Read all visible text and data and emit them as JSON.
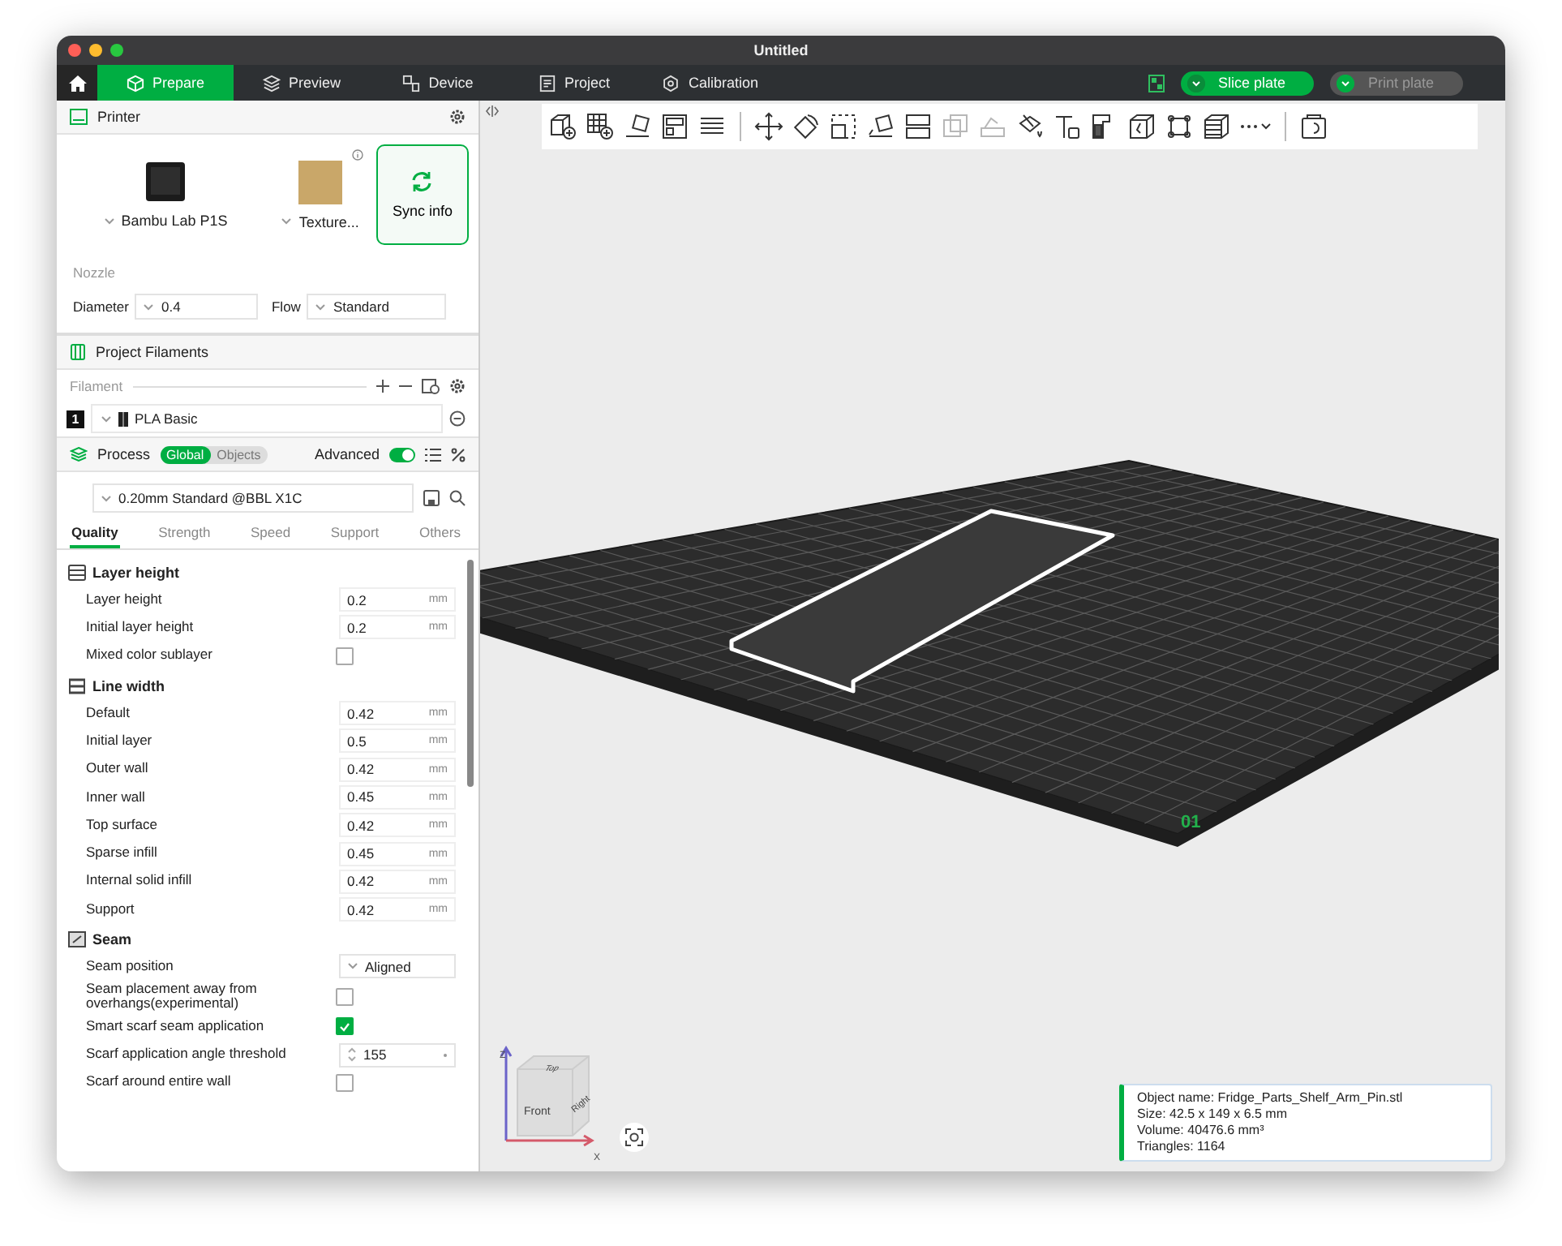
{
  "window": {
    "title": "Untitled"
  },
  "topbar": {
    "tabs": [
      {
        "label": "Prepare",
        "selected": true
      },
      {
        "label": "Preview",
        "selected": false
      },
      {
        "label": "Device",
        "selected": false
      },
      {
        "label": "Project",
        "selected": false
      },
      {
        "label": "Calibration",
        "selected": false
      }
    ],
    "slice_button": {
      "label": "Slice plate",
      "disabled": false
    },
    "print_button": {
      "label": "Print plate",
      "disabled": true
    }
  },
  "printer": {
    "title": "Printer",
    "printer_name": "Bambu Lab P1S",
    "plate_name": "Texture...",
    "sync_label": "Sync info",
    "nozzle_label": "Nozzle",
    "diameter_label": "Diameter",
    "diameter_value": "0.4",
    "flow_label": "Flow",
    "flow_value": "Standard"
  },
  "filaments": {
    "title": "Project Filaments",
    "filament_label": "Filament",
    "items": [
      {
        "index": "1",
        "name": "PLA Basic"
      }
    ]
  },
  "process": {
    "title": "Process",
    "scope_tabs": [
      {
        "label": "Global",
        "selected": true
      },
      {
        "label": "Objects",
        "selected": false
      }
    ],
    "advanced_label": "Advanced",
    "advanced_on": true,
    "preset": "0.20mm Standard @BBL X1C",
    "tabs": [
      {
        "label": "Quality",
        "selected": true
      },
      {
        "label": "Strength",
        "selected": false
      },
      {
        "label": "Speed",
        "selected": false
      },
      {
        "label": "Support",
        "selected": false
      },
      {
        "label": "Others",
        "selected": false
      }
    ],
    "sections": [
      {
        "title": "Layer height",
        "rows": [
          {
            "label": "Layer height",
            "kind": "number",
            "value": "0.2",
            "unit": "mm"
          },
          {
            "label": "Initial layer height",
            "kind": "number",
            "value": "0.2",
            "unit": "mm"
          },
          {
            "label": "Mixed color sublayer",
            "kind": "checkbox",
            "checked": false
          }
        ]
      },
      {
        "title": "Line width",
        "rows": [
          {
            "label": "Default",
            "kind": "number",
            "value": "0.42",
            "unit": "mm"
          },
          {
            "label": "Initial layer",
            "kind": "number",
            "value": "0.5",
            "unit": "mm"
          },
          {
            "label": "Outer wall",
            "kind": "number",
            "value": "0.42",
            "unit": "mm"
          },
          {
            "label": "Inner wall",
            "kind": "number",
            "value": "0.45",
            "unit": "mm"
          },
          {
            "label": "Top surface",
            "kind": "number",
            "value": "0.42",
            "unit": "mm"
          },
          {
            "label": "Sparse infill",
            "kind": "number",
            "value": "0.45",
            "unit": "mm"
          },
          {
            "label": "Internal solid infill",
            "kind": "number",
            "value": "0.42",
            "unit": "mm"
          },
          {
            "label": "Support",
            "kind": "number",
            "value": "0.42",
            "unit": "mm"
          }
        ]
      },
      {
        "title": "Seam",
        "rows": [
          {
            "label": "Seam position",
            "kind": "select",
            "value": "Aligned"
          },
          {
            "label": "Seam placement away from overhangs(experimental)",
            "kind": "checkbox",
            "checked": false
          },
          {
            "label": "Smart scarf seam application",
            "kind": "checkbox",
            "checked": true
          },
          {
            "label": "Scarf application angle threshold",
            "kind": "spin",
            "value": "155"
          },
          {
            "label": "Scarf around entire wall",
            "kind": "checkbox",
            "checked": false
          }
        ]
      }
    ]
  },
  "viewport": {
    "plate_number": "01",
    "cube_labels": {
      "top": "Top",
      "front": "Front",
      "right": "Right"
    },
    "axis_z": "Z",
    "axis_x": "X",
    "info": [
      "Object name: Fridge_Parts_Shelf_Arm_Pin.stl",
      "Size: 42.5 x 149 x 6.5 mm",
      "Volume: 40476.6 mm³",
      "Triangles: 1164"
    ]
  }
}
